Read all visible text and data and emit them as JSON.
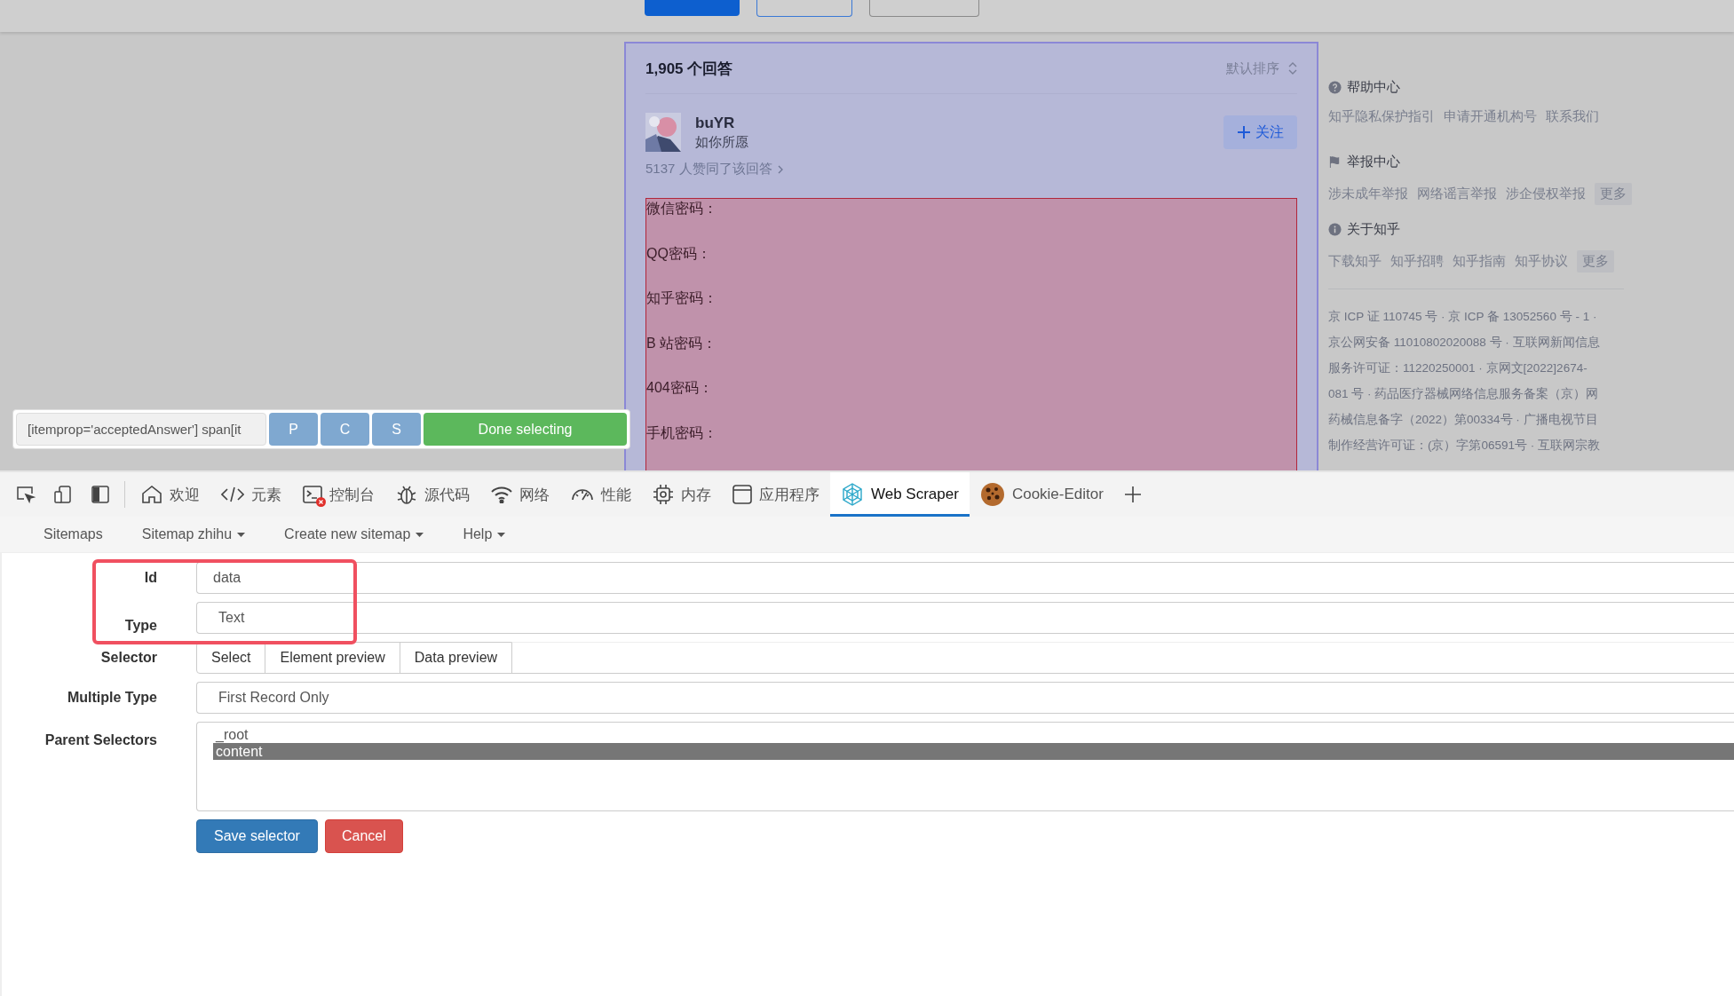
{
  "page": {
    "top_buttons": [
      {
        "kind": "primary"
      },
      {
        "kind": "outline-blue"
      },
      {
        "kind": "outline-gray"
      }
    ],
    "answers": {
      "count": "1,905 个回答",
      "sort": "默认排序"
    },
    "author": {
      "name": "buYR",
      "bio": "如你所愿",
      "follow": "关注"
    },
    "votes": "5137 人赞同了该回答",
    "content_lines": [
      "微信密码：",
      "QQ密码：",
      "知乎密码：",
      "B 站密码：",
      "404密码：",
      "手机密码："
    ]
  },
  "sidebar": {
    "sections": [
      {
        "kind": "help",
        "title": "帮助中心",
        "links": [
          "知乎隐私保护指引",
          "申请开通机构号",
          "联系我们"
        ]
      },
      {
        "kind": "report",
        "title": "举报中心",
        "links": [
          "涉未成年举报",
          "网络谣言举报",
          "涉企侵权举报"
        ],
        "more": "更多"
      },
      {
        "kind": "info",
        "title": "关于知乎",
        "links": [
          "下载知乎",
          "知乎招聘",
          "知乎指南",
          "知乎协议"
        ],
        "more": "更多"
      }
    ],
    "license_lines": [
      "京 ICP 证 110745 号 · 京 ICP 备 13052560 号 - 1 ·",
      "京公网安备 11010802020088 号 · 互联网新闻信息",
      "服务许可证：11220250001 · 京网文[2022]2674-",
      "081 号 · 药品医疗器械网络信息服务备案（京）网",
      "药械信息备字（2022）第00334号 · 广播电视节目",
      "制作经营许可证：(京）字第06591号 · 互联网宗教"
    ]
  },
  "selector_bar": {
    "value": "[itemprop='acceptedAnswer'] span[it",
    "buttons": [
      "P",
      "C",
      "S"
    ],
    "done": "Done selecting"
  },
  "devtools": {
    "tools": [
      {
        "kind": "inspect"
      },
      {
        "kind": "device"
      },
      {
        "kind": "dock"
      }
    ],
    "tabs": [
      {
        "kind": "home",
        "label": "欢迎",
        "selected": false,
        "badge": false
      },
      {
        "kind": "code",
        "label": "元素",
        "selected": false,
        "badge": false
      },
      {
        "kind": "console",
        "label": "控制台",
        "selected": false,
        "badge": true
      },
      {
        "kind": "bug",
        "label": "源代码",
        "selected": false,
        "badge": false
      },
      {
        "kind": "wifi",
        "label": "网络",
        "selected": false,
        "badge": false
      },
      {
        "kind": "gauge",
        "label": "性能",
        "selected": false,
        "badge": false
      },
      {
        "kind": "chip",
        "label": "内存",
        "selected": false,
        "badge": false
      },
      {
        "kind": "window",
        "label": "应用程序",
        "selected": false,
        "badge": false
      },
      {
        "kind": "web",
        "label": "Web Scraper",
        "selected": true,
        "badge": false
      },
      {
        "kind": "cookie",
        "label": "Cookie-Editor",
        "selected": false,
        "badge": false
      }
    ]
  },
  "menu": [
    {
      "label": "Sitemaps",
      "dropdown": false
    },
    {
      "label": "Sitemap zhihu",
      "dropdown": true
    },
    {
      "label": "Create new sitemap",
      "dropdown": true
    },
    {
      "label": "Help",
      "dropdown": true
    }
  ],
  "form": {
    "id": {
      "label": "Id",
      "value": "data"
    },
    "type": {
      "label": "Type",
      "value": "Text"
    },
    "selector": {
      "label": "Selector",
      "buttons": [
        "Select",
        "Element preview",
        "Data preview"
      ]
    },
    "multiple_type": {
      "label": "Multiple Type",
      "value": "First Record Only"
    },
    "parent_selectors": {
      "label": "Parent Selectors",
      "options": [
        {
          "label": "_root",
          "selected": false
        },
        {
          "label": "content",
          "selected": true
        }
      ]
    },
    "save": "Save selector",
    "cancel": "Cancel",
    "highlight": true
  }
}
